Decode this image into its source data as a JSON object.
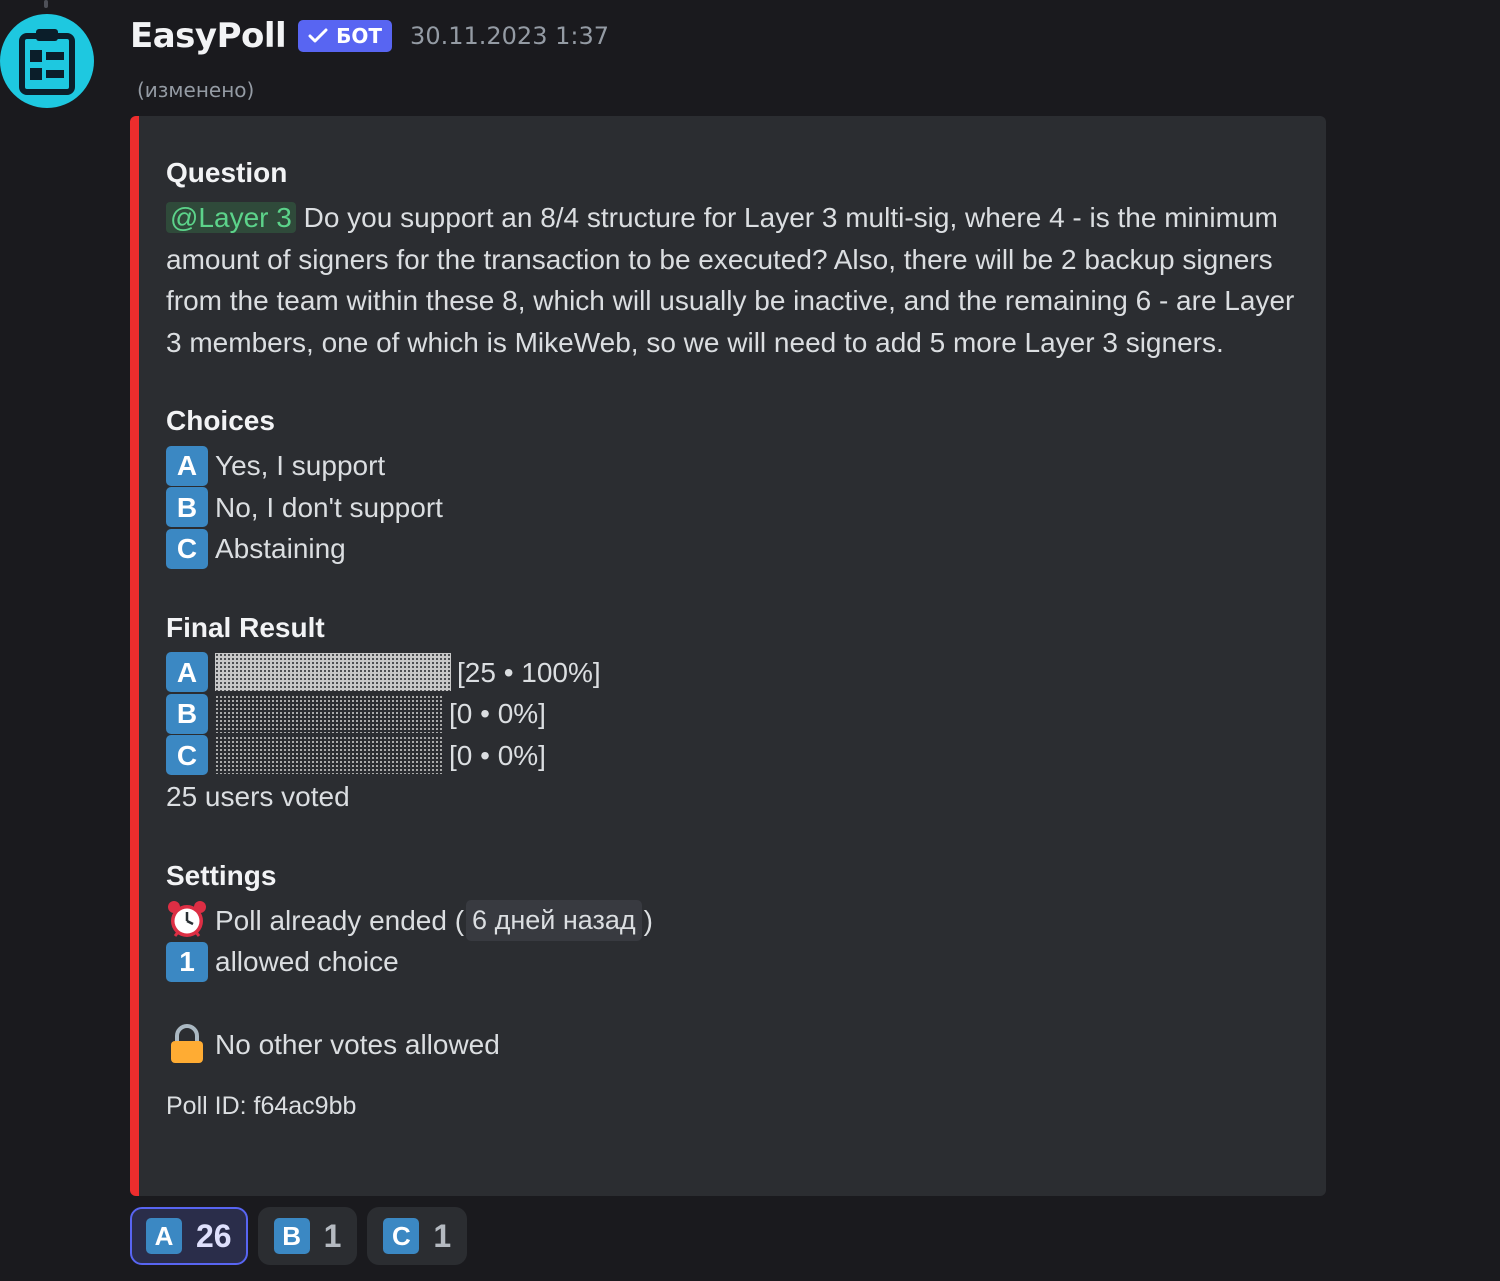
{
  "message": {
    "author": "EasyPoll",
    "bot_tag": "БОТ",
    "timestamp": "30.11.2023 1:37",
    "edited": "(изменено)",
    "avatar_icon": "clipboard-icon"
  },
  "embed": {
    "accent_color": "#ed2d2d",
    "question": {
      "title": "Question",
      "mention": "@Layer 3",
      "text": " Do you support an 8/4 structure for Layer 3 multi-sig, where 4 - is the minimum amount of signers for the transaction to be executed? Also, there will be 2 backup signers from the team within these 8, which will usually be inactive, and the remaining 6 - are Layer 3 members, one of which is MikeWeb, so we will need to add 5 more Layer 3 signers."
    },
    "choices": {
      "title": "Choices",
      "items": [
        {
          "letter": "A",
          "label": "Yes, I support"
        },
        {
          "letter": "B",
          "label": "No, I don't support"
        },
        {
          "letter": "C",
          "label": "Abstaining"
        }
      ]
    },
    "result": {
      "title": "Final Result",
      "rows": [
        {
          "letter": "A",
          "fill_fraction": 1.0,
          "label": "[25 • 100%]"
        },
        {
          "letter": "B",
          "fill_fraction": 0.0,
          "label": "[0 • 0%]"
        },
        {
          "letter": "C",
          "fill_fraction": 0.0,
          "label": "[0 • 0%]"
        }
      ],
      "total": "25 users voted"
    },
    "settings": {
      "title": "Settings",
      "ended_prefix": "Poll already ended (",
      "ended_relative": "6 дней назад",
      "ended_suffix": ")",
      "allowed_badge": "1",
      "allowed_text": "allowed choice",
      "no_other_votes": "No other votes allowed"
    },
    "footer": "Poll ID: f64ac9bb"
  },
  "reactions": [
    {
      "letter": "A",
      "count": "26",
      "active": true
    },
    {
      "letter": "B",
      "count": "1",
      "active": false
    },
    {
      "letter": "C",
      "count": "1",
      "active": false
    }
  ]
}
